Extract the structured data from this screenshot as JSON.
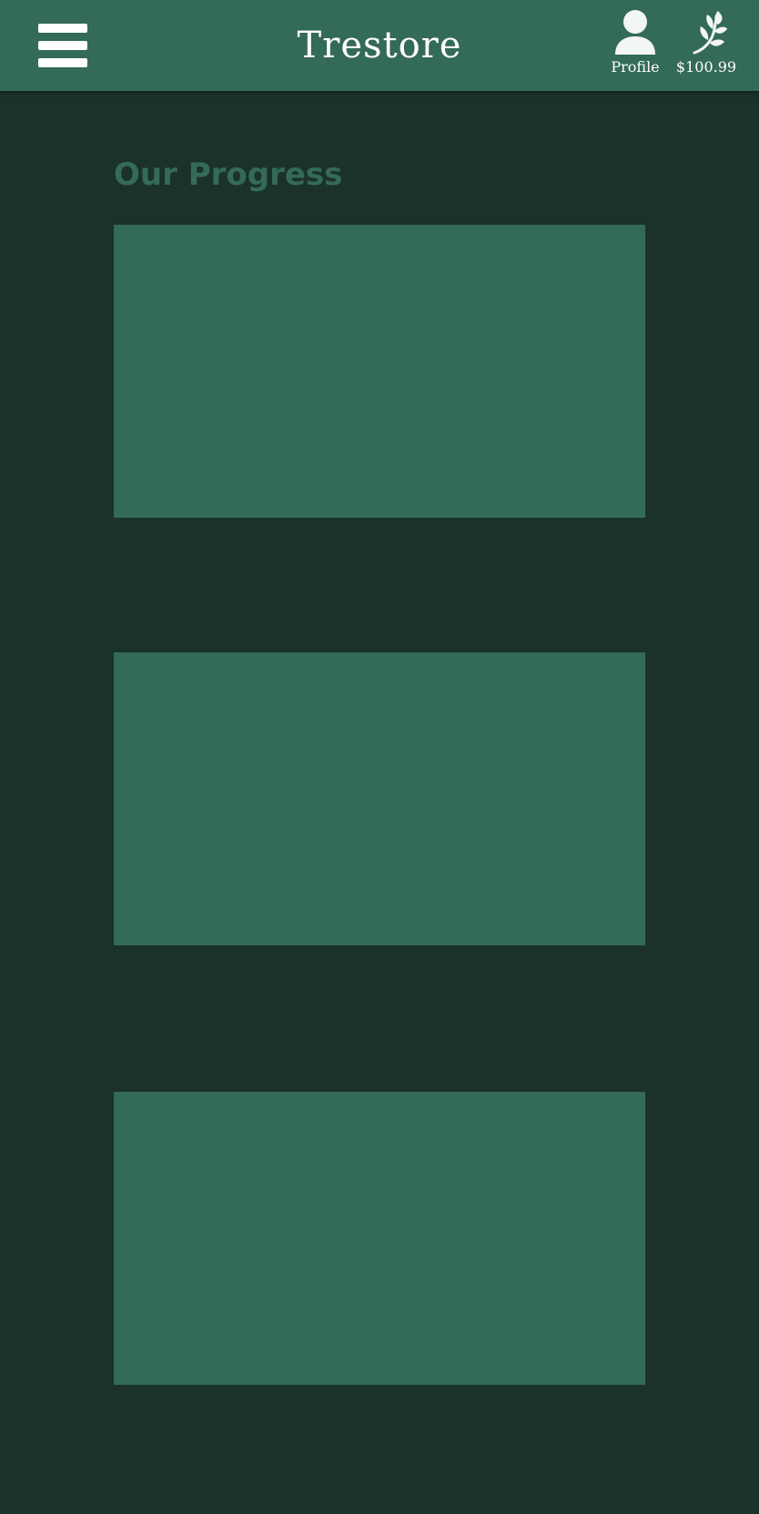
{
  "header": {
    "brand": "Trestore",
    "menu_icon": "hamburger-menu-icon",
    "profile": {
      "label": "Profile",
      "icon": "user-icon"
    },
    "balance": {
      "label": "$100.99",
      "icon": "sprout-icon"
    }
  },
  "main": {
    "title": "Our Progress",
    "cards": [
      {
        "label": ""
      },
      {
        "label": ""
      },
      {
        "label": ""
      }
    ]
  },
  "colors": {
    "background": "#1b3229",
    "header": "#346a58",
    "card": "#346a58",
    "title": "#346a58",
    "text_on_header": "#ffffff"
  }
}
